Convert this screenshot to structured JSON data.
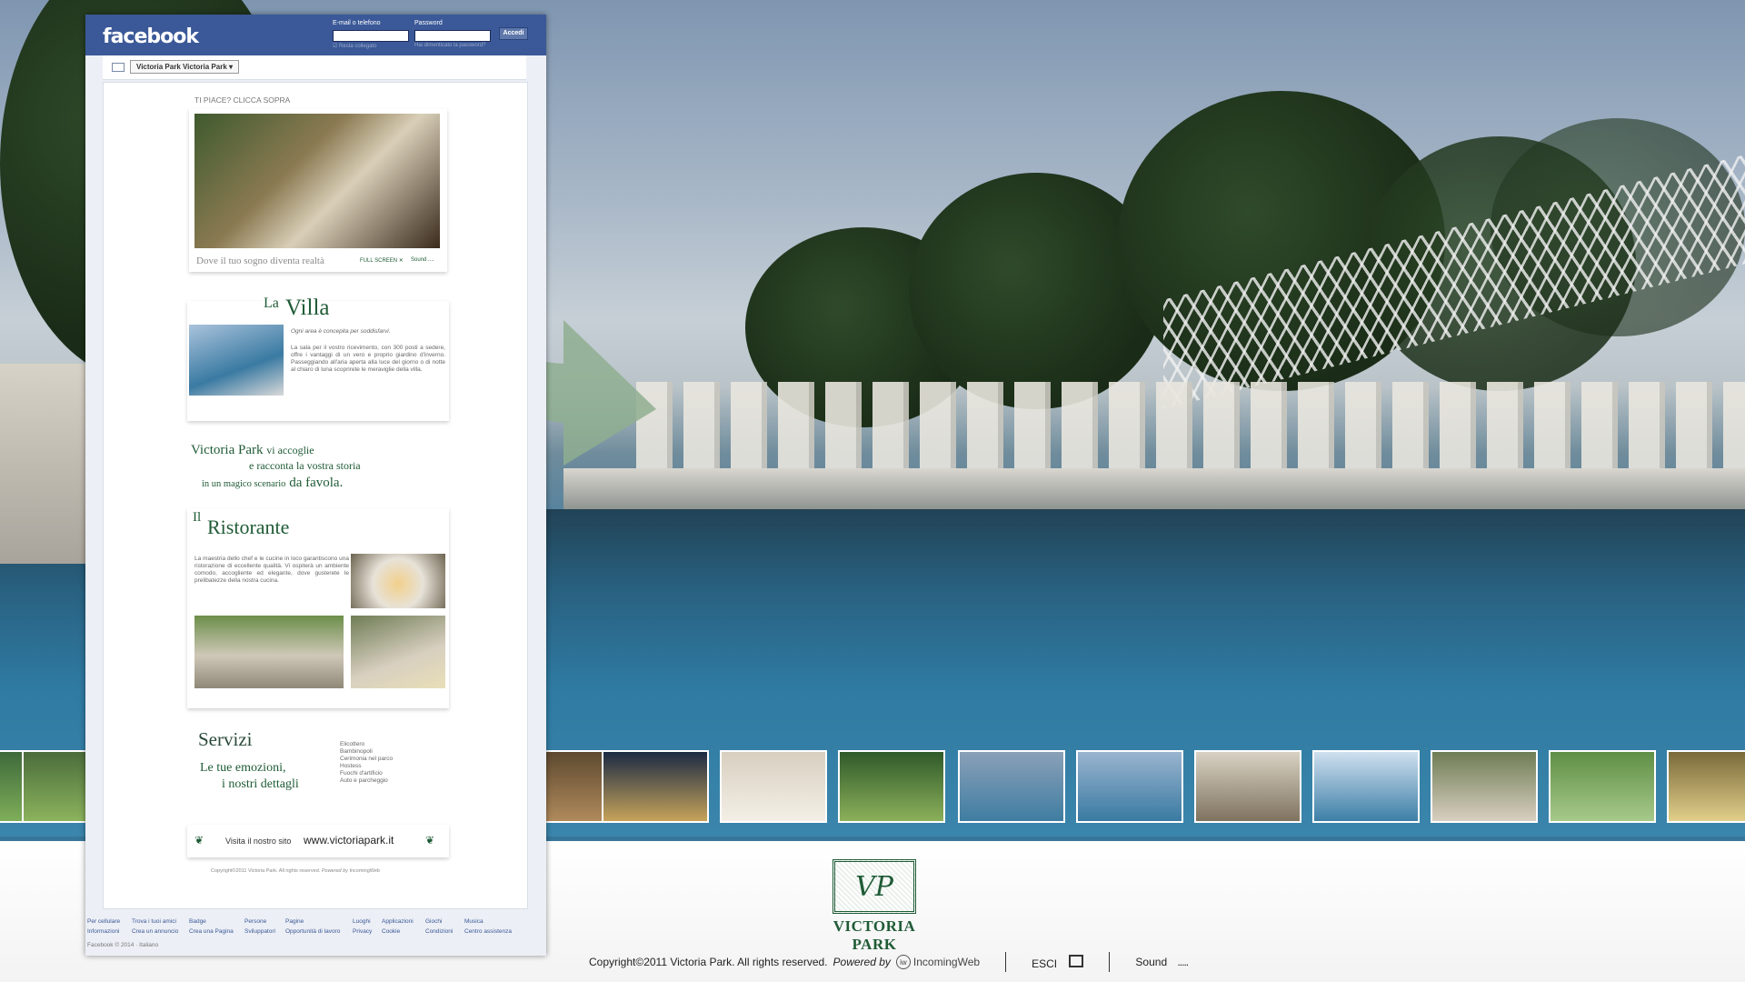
{
  "facebook": {
    "logo": "facebook",
    "email_label": "E-mail o telefono",
    "password_label": "Password",
    "login_button": "Accedi",
    "remember_label": "Resta collegato",
    "forgot_link": "Hai dimenticato la password?",
    "page_selector": "Victoria Park  Victoria Park",
    "footer_links_row1": [
      "Per cellulare",
      "Trova i tuoi amici",
      "Badge",
      "Persone",
      "Pagine",
      "Luoghi",
      "Applicazioni",
      "Giochi",
      "Musica"
    ],
    "footer_links_row2": [
      "Informazioni",
      "Crea un annuncio",
      "Crea una Pagina",
      "Sviluppatori",
      "Opportunità di lavoro",
      "Privacy",
      "Cookie",
      "Condizioni",
      "Centro assistenza"
    ],
    "copyright": "Facebook © 2014 · Italiano"
  },
  "tab": {
    "like_prompt": "TI PIACE? CLICCA SOPRA",
    "hero_caption": "Dove il tuo sogno diventa realtà",
    "fullscreen_label": "FULL SCREEN",
    "sound_label": "Sound",
    "villa": {
      "title_la": "La",
      "title_villa": "Villa",
      "subtitle": "Ogni area è concepita per soddisfarvi.",
      "body": "La sala per il vostro ricevimento, con 300 posti a sedere, offre i vantaggi di un vero e proprio giardino d'inverno. Passeggiando all'aria aperta alla luce del giorno o di notte al chiaro di luna scoprirete le meraviglie della villa."
    },
    "welcome": {
      "line1a": "Victoria Park",
      "line1b": "vi accoglie",
      "line2": "e racconta la vostra storia",
      "line3a": "in un magico scenario",
      "line3b": "da favola."
    },
    "restaurant": {
      "title_il": "Il",
      "title": "Ristorante",
      "body": "La maestria dello chef e le cucine in loco garantiscono una ristorazione di eccellente qualità. Vi ospiterà un ambiente comodo, accogliente ed elegante, dove gusterete le prelibatezze della nostra cucina."
    },
    "services": {
      "title": "Servizi",
      "tagline1": "Le tue emozioni,",
      "tagline2": "i nostri dettagli",
      "items": [
        "Elicottero",
        "Bambinopoli",
        "Cerimonia nel parco",
        "Hostess",
        "Fuochi d'artificio",
        "Auto e parcheggio"
      ]
    },
    "visit_label": "Visita il nostro sito",
    "visit_url": "www.victoriapark.it",
    "mini_copyright": "Copyright©2011 Victoria Park. All rights reserved.",
    "mini_powered": "Powered by",
    "mini_brand": "IncomingWeb"
  },
  "site": {
    "logo_monogram": "VP",
    "logo_name": "VICTORIA PARK",
    "copyright": "Copyright©2011 Victoria Park. All rights reserved.",
    "powered_by": "Powered by",
    "brand": "IncomingWeb",
    "exit_label": "ESCI",
    "sound_label": "Sound",
    "sound_dots": "....."
  },
  "colors": {
    "facebook_blue": "#3b5998",
    "brand_green": "#1f5b36",
    "arrow": "#8fae90"
  }
}
